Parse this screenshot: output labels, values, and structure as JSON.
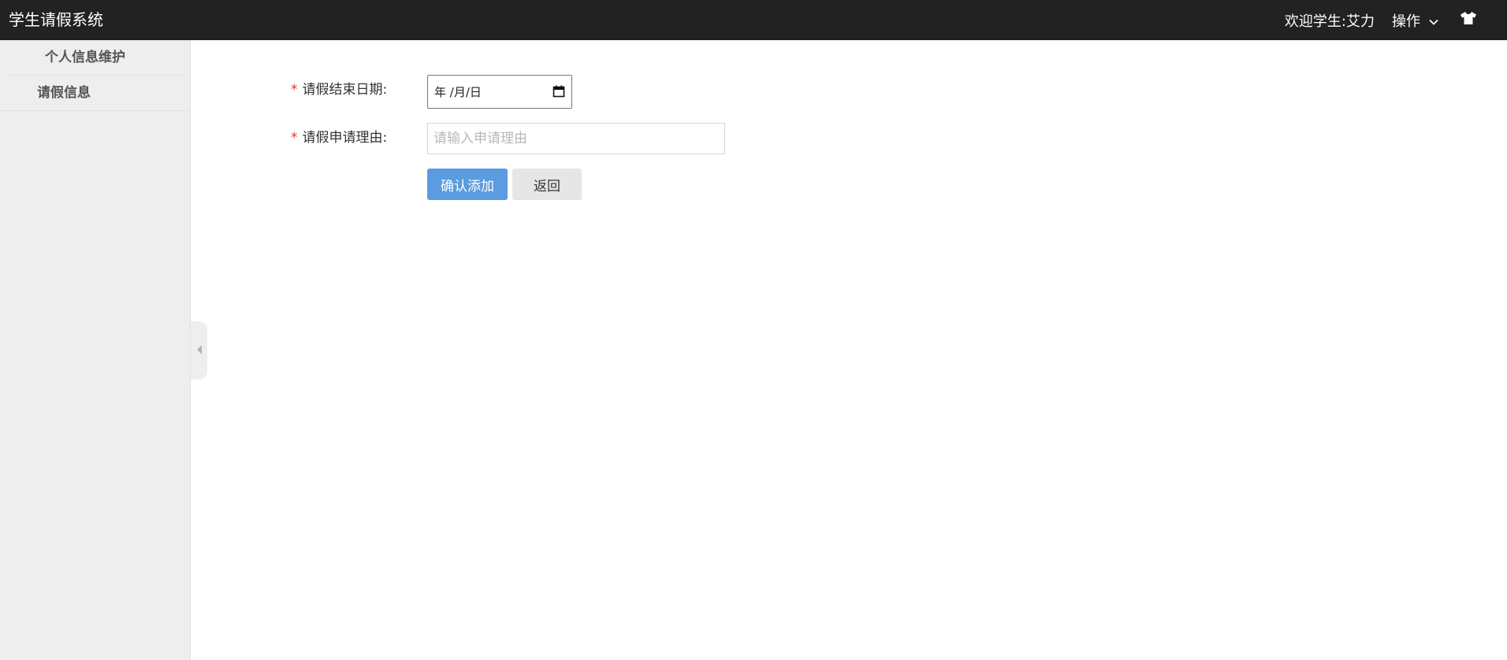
{
  "header": {
    "app_title": "学生请假系统",
    "welcome_text": "欢迎学生:艾力",
    "operations_label": "操作",
    "operations_icon": "chevron-down-icon",
    "theme_icon": "tshirt-icon",
    "background_color": "#222222"
  },
  "sidebar": {
    "items": [
      {
        "label": "个人信息维护"
      },
      {
        "label": "请假信息"
      }
    ],
    "collapse_icon": "chevron-left-icon",
    "background_color": "#eeeeee"
  },
  "form": {
    "end_date": {
      "required_mark": "*",
      "label": "请假结束日期:",
      "display_value": "年 /月/日",
      "icon": "calendar-icon"
    },
    "reason": {
      "required_mark": "*",
      "label": "请假申请理由:",
      "value": "",
      "placeholder": "请输入申请理由"
    },
    "buttons": {
      "confirm_label": "确认添加",
      "back_label": "返回"
    },
    "primary_color": "#5b9be0",
    "required_color": "#e0352b"
  }
}
